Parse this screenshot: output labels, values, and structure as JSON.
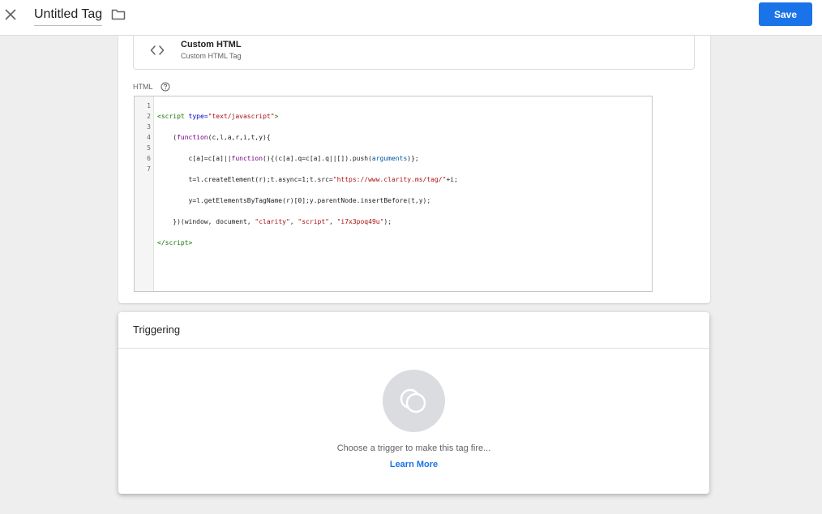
{
  "header": {
    "title": "Untitled Tag",
    "save_label": "Save"
  },
  "tag_type": {
    "name": "Custom HTML",
    "description": "Custom HTML Tag"
  },
  "editor": {
    "label": "HTML",
    "line_numbers": [
      "1",
      "2",
      "3",
      "4",
      "5",
      "6",
      "7"
    ]
  },
  "triggering": {
    "title": "Triggering",
    "message": "Choose a trigger to make this tag fire...",
    "learn_more": "Learn More"
  },
  "colors": {
    "accent": "#1a73e8",
    "code_tag": "#117700",
    "code_string": "#aa1111",
    "code_keyword": "#770088"
  },
  "icons": {
    "close": "close-icon",
    "folder": "folder-icon",
    "code": "code-brackets-icon",
    "help": "help-circle-icon",
    "trigger": "trigger-overlap-circles-icon"
  }
}
